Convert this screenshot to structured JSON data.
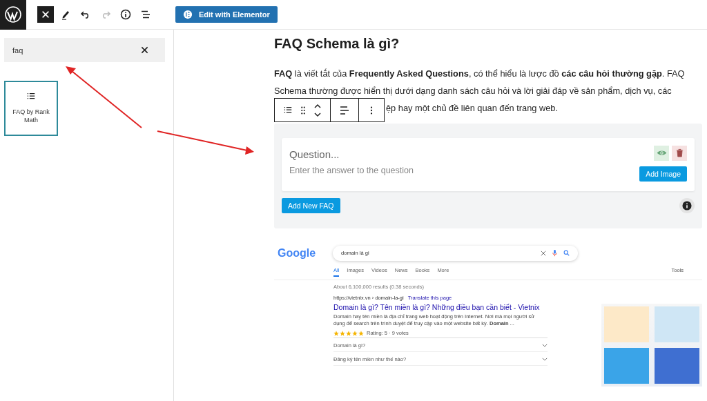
{
  "top_bar": {
    "tools": [
      {
        "kind": "close",
        "pressed": true,
        "disabled": false
      },
      {
        "kind": "edit",
        "pressed": false,
        "disabled": false
      },
      {
        "kind": "undo",
        "pressed": false,
        "disabled": false
      },
      {
        "kind": "redo",
        "pressed": false,
        "disabled": true
      },
      {
        "kind": "info",
        "pressed": false,
        "disabled": false
      },
      {
        "kind": "outline",
        "pressed": false,
        "disabled": false
      }
    ],
    "elementor_button": "Edit with Elementor"
  },
  "inserter": {
    "search": {
      "value": "faq"
    },
    "blocks": [
      {
        "label": "FAQ by Rank Math",
        "selected": true
      }
    ]
  },
  "content": {
    "heading": "FAQ Schema là gì?",
    "paragraph": "**FAQ** là viết tắt của **Frequently Asked Questions**, có thể hiểu là lược đồ **các câu hỏi thường gặp**. FAQ Schema thường được hiển thị dưới dạng danh sách câu hỏi và lời giải đáp về sản phẩm, dịch vụ, các",
    "paragraph_tail": "ệp hay một chủ đề liên quan đến trang web.",
    "faq_block": {
      "items": [
        {
          "question_placeholder": "Question...",
          "answer_placeholder": "Enter the answer to the question",
          "add_image": "Add Image"
        }
      ],
      "add_new": "Add New FAQ"
    },
    "search_screenshot": {
      "logo": "Google",
      "query": "domain là gi",
      "tabs": [
        {
          "label": "All",
          "selected": true
        },
        {
          "label": "Images",
          "selected": false
        },
        {
          "label": "Videos",
          "selected": false
        },
        {
          "label": "News",
          "selected": false
        },
        {
          "label": "Books",
          "selected": false
        },
        {
          "label": "More",
          "selected": false
        }
      ],
      "tools": "Tools",
      "stats": "About 6,100,000 results (0.38 seconds)",
      "result": {
        "url": "https://vietnix.vn › domain-la-gi",
        "translate": "Translate this page",
        "title": "Domain là gì? Tên miền là gì? Những điều bạn cần biết - Vietnix",
        "snippet": "Domain hay tên miền là địa chỉ trang web hoạt động trên Internet. Nơi mà mọi người sử dụng để search trên trình duyệt để truy cập vào một website bất kỳ. **Domain** ...",
        "stars": 5,
        "rating": "Rating: 5 · 9 votes",
        "questions": [
          "Domain là gì?",
          "Đăng ký tên miền như thế nào?"
        ]
      }
    }
  }
}
